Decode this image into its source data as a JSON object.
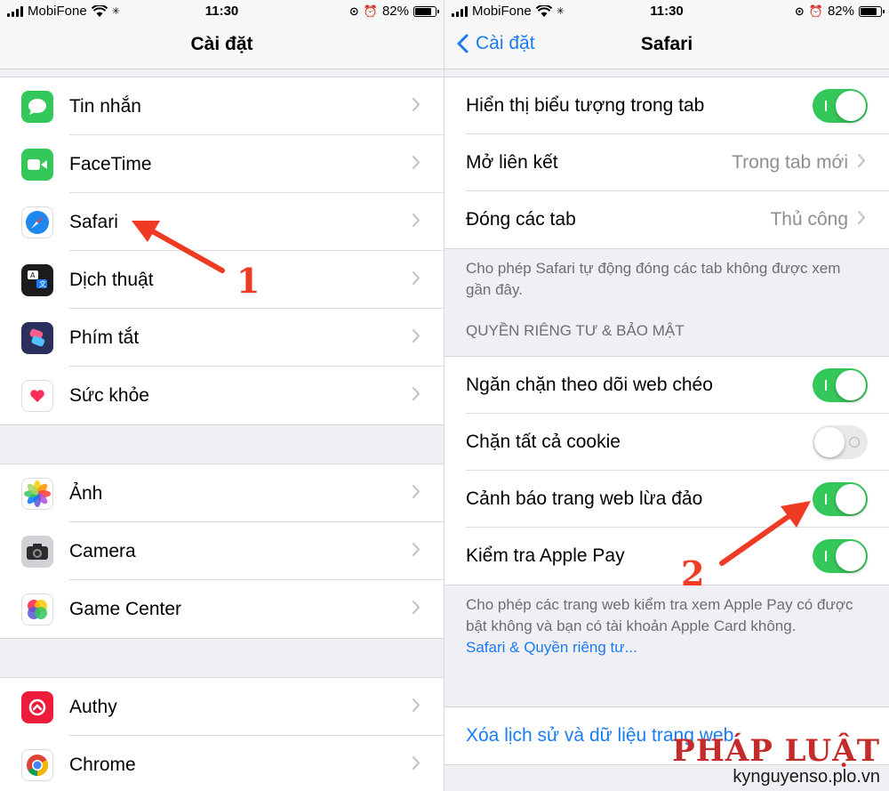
{
  "status_bar": {
    "carrier": "MobiFone",
    "time": "11:30",
    "battery": "82%",
    "battery_level": 0.82
  },
  "left": {
    "title": "Cài đặt",
    "groups": [
      [
        {
          "label": "Tin nhắn",
          "icon": "messages-icon"
        },
        {
          "label": "FaceTime",
          "icon": "facetime-icon"
        },
        {
          "label": "Safari",
          "icon": "safari-icon"
        },
        {
          "label": "Dịch thuật",
          "icon": "translate-icon"
        },
        {
          "label": "Phím tắt",
          "icon": "shortcuts-icon"
        },
        {
          "label": "Sức khỏe",
          "icon": "health-icon"
        }
      ],
      [
        {
          "label": "Ảnh",
          "icon": "photos-icon"
        },
        {
          "label": "Camera",
          "icon": "camera-icon"
        },
        {
          "label": "Game Center",
          "icon": "game-center-icon"
        }
      ],
      [
        {
          "label": "Authy",
          "icon": "authy-icon"
        },
        {
          "label": "Chrome",
          "icon": "chrome-icon"
        }
      ]
    ],
    "annotation_number": "1"
  },
  "right": {
    "back_label": "Cài đặt",
    "title": "Safari",
    "group1": [
      {
        "label": "Hiển thị biểu tượng trong tab",
        "toggle": true
      },
      {
        "label": "Mở liên kết",
        "value": "Trong tab mới"
      },
      {
        "label": "Đóng các tab",
        "value": "Thủ công"
      }
    ],
    "group1_footer": "Cho phép Safari tự động đóng các tab không được xem gần đây.",
    "privacy_header": "QUYỀN RIÊNG TƯ & BẢO MẬT",
    "group2": [
      {
        "label": "Ngăn chặn theo dõi web chéo",
        "toggle": true
      },
      {
        "label": "Chặn tất cả cookie",
        "toggle": false
      },
      {
        "label": "Cảnh báo trang web lừa đảo",
        "toggle": true
      },
      {
        "label": "Kiểm tra Apple Pay",
        "toggle": true
      }
    ],
    "group2_footer": "Cho phép các trang web kiểm tra xem Apple Pay có được bật không và bạn có tài khoản Apple Card không.",
    "privacy_link": "Safari & Quyền riêng tư...",
    "clear_history": "Xóa lịch sử và dữ liệu trang web",
    "annotation_number": "2"
  },
  "watermark": {
    "logo": "PHÁP LUẬT",
    "site": "kynguyenso.plo.vn"
  },
  "colors": {
    "accent": "#1a7cf5",
    "toggle_on": "#34c759",
    "annotation": "#ef3b24"
  }
}
